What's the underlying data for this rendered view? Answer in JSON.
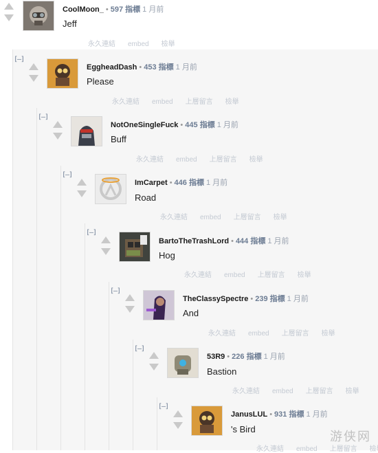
{
  "collapse_symbol": "[–]",
  "score_unit": "指標",
  "actions": {
    "permalink": "永久連結",
    "embed": "embed",
    "parent": "上層留言",
    "report": "檢舉"
  },
  "comments": [
    {
      "author": "CoolMoon_",
      "score": "597",
      "time": "1 月前",
      "text": "Jeff",
      "avatar_icon": "roadhog-avatar-icon"
    },
    {
      "author": "EggheadDash",
      "score": "453",
      "time": "1 月前",
      "text": "Please",
      "avatar_icon": "junkrat-avatar-icon"
    },
    {
      "author": "NotOneSingleFuck",
      "score": "445",
      "time": "1 月前",
      "text": "Buff",
      "avatar_icon": "soldier-avatar-icon"
    },
    {
      "author": "ImCarpet",
      "score": "446",
      "time": "1 月前",
      "text": "Road",
      "avatar_icon": "overwatch-logo-icon"
    },
    {
      "author": "BartoTheTrashLord",
      "score": "444",
      "time": "1 月前",
      "text": "Hog",
      "avatar_icon": "pixel-roadhog-avatar-icon"
    },
    {
      "author": "TheClassySpectre",
      "score": "239",
      "time": "1 月前",
      "text": "And",
      "avatar_icon": "sombra-avatar-icon"
    },
    {
      "author": "53R9",
      "score": "226",
      "time": "1 月前",
      "text": "Bastion",
      "avatar_icon": "bastion-avatar-icon"
    },
    {
      "author": "JanusLUL",
      "score": "931",
      "time": "1 月前",
      "text": "'s Bird",
      "avatar_icon": "junkrat-avatar-icon"
    }
  ],
  "watermark": "游侠网"
}
